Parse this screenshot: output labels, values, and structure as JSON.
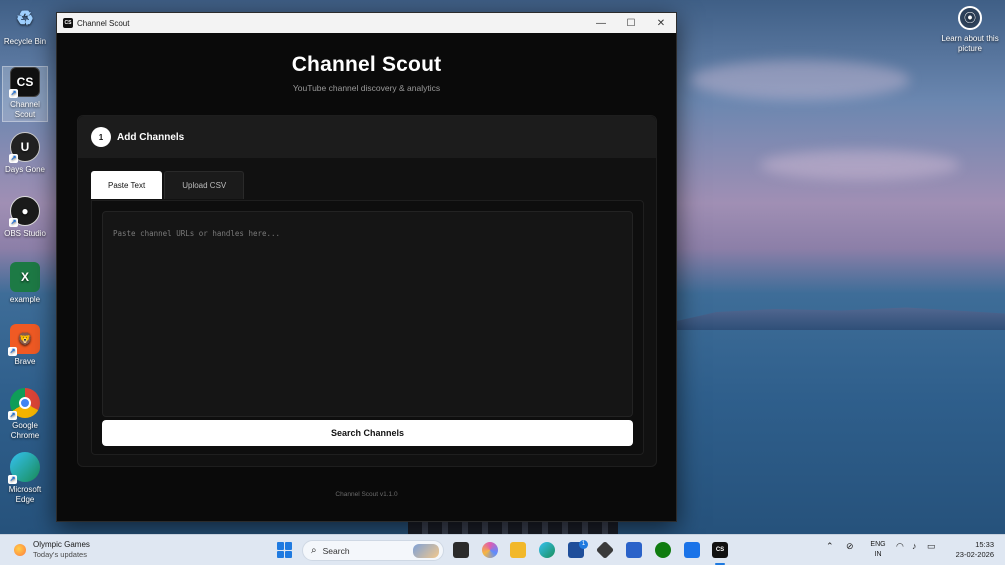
{
  "desktop": {
    "icons": [
      {
        "label": "Recycle Bin"
      },
      {
        "label": "Channel Scout"
      },
      {
        "label": "Days Gone"
      },
      {
        "label": "OBS Studio"
      },
      {
        "label": "example"
      },
      {
        "label": "Brave"
      },
      {
        "label": "Google Chrome"
      },
      {
        "label": "Microsoft Edge"
      }
    ],
    "learn_label": "Learn about this picture"
  },
  "window": {
    "title": "Channel Scout",
    "app_icon_text": "CS",
    "controls": {
      "minimize": "—",
      "maximize": "☐",
      "close": "✕"
    }
  },
  "app": {
    "title": "Channel Scout",
    "subtitle": "YouTube channel discovery & analytics",
    "step": {
      "number": "1",
      "title": "Add Channels"
    },
    "tabs": [
      {
        "label": "Paste Text",
        "active": true
      },
      {
        "label": "Upload CSV",
        "active": false
      }
    ],
    "input": {
      "placeholder": "Paste channel URLs or handles here...",
      "value": ""
    },
    "search_button": "Search Channels",
    "footer": "Channel Scout v1.1.0"
  },
  "taskbar": {
    "weather": {
      "title": "Olympic Games",
      "subtitle": "Today's updates"
    },
    "search_placeholder": "Search",
    "store_badge": "1",
    "language": {
      "line1": "ENG",
      "line2": "IN"
    },
    "clock": {
      "time": "15:33",
      "date": "23-02-2026"
    },
    "accent": "#1f7ae0"
  }
}
